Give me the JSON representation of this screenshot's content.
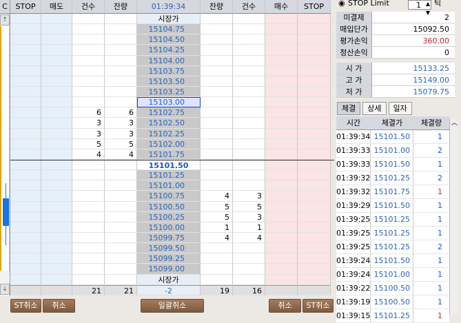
{
  "left_strip": {
    "label": "C",
    "up_arrow": "↑",
    "down_arrow": "↓"
  },
  "headers": [
    "STOP",
    "매도",
    "건수",
    "잔량",
    "01:39:34",
    "잔량",
    "건수",
    "매수",
    "STOP"
  ],
  "market_label_top": "시장가",
  "market_label_bottom": "시장가",
  "ask_rows": [
    {
      "price": "15104.75",
      "count": "",
      "qty": ""
    },
    {
      "price": "15104.50",
      "count": "",
      "qty": ""
    },
    {
      "price": "15104.25",
      "count": "",
      "qty": ""
    },
    {
      "price": "15104.00",
      "count": "",
      "qty": ""
    },
    {
      "price": "15103.75",
      "count": "",
      "qty": ""
    },
    {
      "price": "15103.50",
      "count": "",
      "qty": ""
    },
    {
      "price": "15103.25",
      "count": "",
      "qty": ""
    },
    {
      "price": "15103.00",
      "count": "",
      "qty": ""
    },
    {
      "price": "15102.75",
      "count": "6",
      "qty": "6"
    },
    {
      "price": "15102.50",
      "count": "3",
      "qty": "3"
    },
    {
      "price": "15102.25",
      "count": "3",
      "qty": "3"
    },
    {
      "price": "15102.00",
      "count": "5",
      "qty": "5"
    },
    {
      "price": "15101.75",
      "count": "4",
      "qty": "4"
    }
  ],
  "current_price": "15101.50",
  "bid_rows": [
    {
      "price": "15101.25",
      "qty": "",
      "count": ""
    },
    {
      "price": "15101.00",
      "qty": "",
      "count": ""
    },
    {
      "price": "15100.75",
      "qty": "4",
      "count": "3"
    },
    {
      "price": "15100.50",
      "qty": "5",
      "count": "5"
    },
    {
      "price": "15100.25",
      "qty": "5",
      "count": "3"
    },
    {
      "price": "15100.00",
      "qty": "1",
      "count": "1"
    },
    {
      "price": "15099.75",
      "qty": "4",
      "count": "4"
    },
    {
      "price": "15099.50",
      "qty": "",
      "count": ""
    },
    {
      "price": "15099.25",
      "qty": "",
      "count": ""
    },
    {
      "price": "15099.00",
      "qty": "",
      "count": ""
    }
  ],
  "totals": {
    "ask_count": "21",
    "ask_qty": "21",
    "diff": "-2",
    "bid_qty": "19",
    "bid_count": "16"
  },
  "buttons": {
    "st_cancel_left": "ST취소",
    "cancel_left": "취소",
    "cancel_all": "일괄취소",
    "cancel_right": "취소",
    "st_cancel_right": "ST취소"
  },
  "right": {
    "order_type": "STOP Limit",
    "tick_value": "1",
    "tick_label": "틱",
    "summary": [
      {
        "label": "미결제",
        "value": "2",
        "color": "#000000"
      },
      {
        "label": "매입단가",
        "value": "15092.50",
        "color": "#000000"
      },
      {
        "label": "평가손익",
        "value": "360.00",
        "color": "#cc2222"
      },
      {
        "label": "청산손익",
        "value": "0",
        "color": "#000000"
      }
    ],
    "prices": [
      {
        "label": "시 가",
        "value": "15133.25"
      },
      {
        "label": "고 가",
        "value": "15149.00"
      },
      {
        "label": "저 가",
        "value": "15079.75"
      }
    ],
    "tabs": [
      "체결",
      "상세",
      "일자"
    ],
    "trade_headers": [
      "시간",
      "체결가",
      "체결량"
    ],
    "trades": [
      {
        "time": "01:39:34",
        "price": "15101.50",
        "qty": "1",
        "side": "sell"
      },
      {
        "time": "01:39:33",
        "price": "15101.00",
        "qty": "2",
        "side": "sell"
      },
      {
        "time": "01:39:33",
        "price": "15101.50",
        "qty": "1",
        "side": "sell"
      },
      {
        "time": "01:39:32",
        "price": "15101.25",
        "qty": "2",
        "side": "sell"
      },
      {
        "time": "01:39:32",
        "price": "15101.75",
        "qty": "1",
        "side": "buy"
      },
      {
        "time": "01:39:29",
        "price": "15101.50",
        "qty": "1",
        "side": "sell"
      },
      {
        "time": "01:39:25",
        "price": "15101.25",
        "qty": "1",
        "side": "sell"
      },
      {
        "time": "01:39:25",
        "price": "15101.25",
        "qty": "1",
        "side": "sell"
      },
      {
        "time": "01:39:25",
        "price": "15101.25",
        "qty": "2",
        "side": "sell"
      },
      {
        "time": "01:39:24",
        "price": "15101.50",
        "qty": "1",
        "side": "sell"
      },
      {
        "time": "01:39:24",
        "price": "15101.00",
        "qty": "1",
        "side": "sell"
      },
      {
        "time": "01:39:22",
        "price": "15100.50",
        "qty": "1",
        "side": "sell"
      },
      {
        "time": "01:39:19",
        "price": "15100.50",
        "qty": "1",
        "side": "sell"
      },
      {
        "time": "01:39:15",
        "price": "15101.25",
        "qty": "1",
        "side": "buy"
      }
    ]
  }
}
